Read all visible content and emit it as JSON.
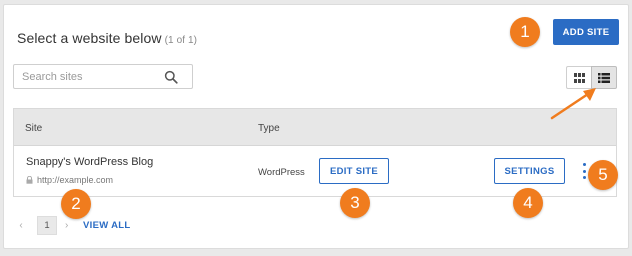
{
  "header": {
    "title": "Select a website below",
    "count": "(1 of 1)",
    "add_site_label": "ADD SITE"
  },
  "search": {
    "placeholder": "Search sites",
    "value": ""
  },
  "view_toggle": {
    "grid_icon": "grid-view-icon",
    "list_icon": "list-view-icon",
    "active": "list"
  },
  "table": {
    "columns": [
      "Site",
      "Type"
    ],
    "rows": [
      {
        "site_name": "Snappy's WordPress Blog",
        "site_url": "http://example.com",
        "type": "WordPress",
        "edit_label": "EDIT SITE",
        "settings_label": "SETTINGS"
      }
    ]
  },
  "pagination": {
    "current_page": "1",
    "view_all_label": "VIEW ALL"
  },
  "callouts": [
    "1",
    "2",
    "3",
    "4",
    "5"
  ],
  "colors": {
    "accent": "#2b6cc4",
    "callout": "#f07c1e"
  }
}
